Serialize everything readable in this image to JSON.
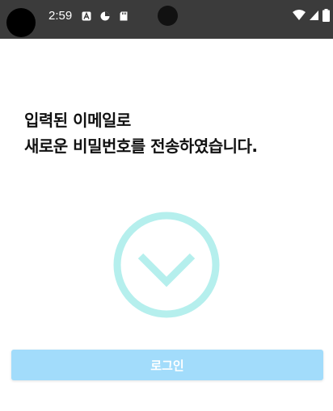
{
  "status_bar": {
    "time": "2:59",
    "notification_icons": [
      "a-icon",
      "pie-chart-icon",
      "sd-card-icon"
    ],
    "system_icons": [
      "wifi-icon",
      "signal-icon",
      "battery-icon"
    ]
  },
  "message": {
    "line1": "입력된 이메일로",
    "line2": "새로운 비밀번호를 전송하였습니다."
  },
  "success_icon": "check-circle-icon",
  "login_button": {
    "label": "로그인"
  },
  "colors": {
    "status_bar_bg": "#3b3b3b",
    "check_color": "#b5efed",
    "button_bg": "#a2dcfb",
    "button_text": "#ffffff"
  }
}
